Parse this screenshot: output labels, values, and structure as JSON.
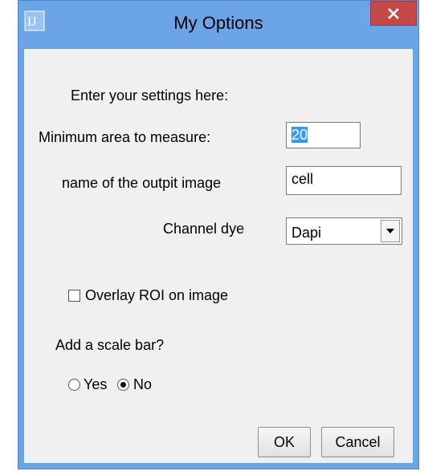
{
  "window": {
    "title": "My Options",
    "app_icon": "imagej-icon",
    "close_icon": "close-icon"
  },
  "form": {
    "intro": "Enter your settings here:",
    "min_area_label": "Minimum area to measure:",
    "min_area_value": "20",
    "output_name_label": "name of the outpit image",
    "output_name_value": "cell",
    "channel_label": "Channel dye",
    "channel_value": "Dapi",
    "overlay_label": "Overlay ROI on image",
    "overlay_checked": false,
    "scale_bar_question": "Add a scale bar?",
    "scale_bar_options": [
      "Yes",
      "No"
    ],
    "scale_bar_selected": "No"
  },
  "buttons": {
    "ok": "OK",
    "cancel": "Cancel"
  },
  "colors": {
    "titlebar": "#6ba5e8",
    "close_button": "#c74848",
    "client_bg": "#f0f0f0",
    "selection": "#3399ff"
  }
}
